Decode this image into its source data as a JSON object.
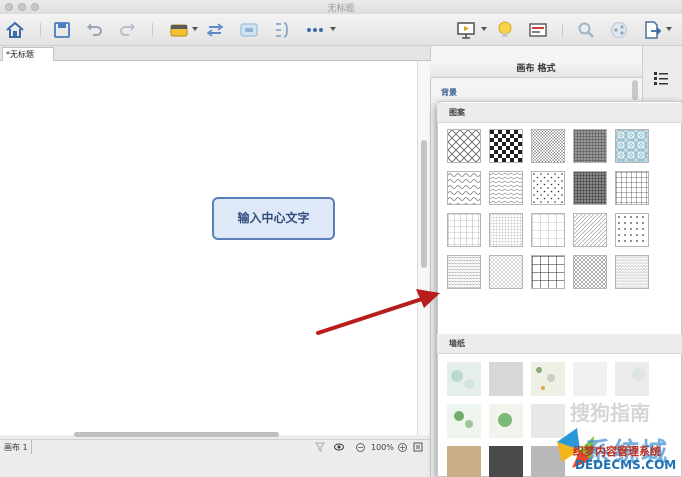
{
  "window": {
    "title": "无标题"
  },
  "toolbar": {
    "icons": [
      "home-icon",
      "save-icon",
      "undo-icon",
      "redo-icon",
      "insert-topic-icon",
      "relationship-icon",
      "boundary-icon",
      "summary-icon",
      "more-icon",
      "presentation-icon",
      "idea-icon",
      "outliner-icon",
      "search-icon",
      "share-icon",
      "export-icon"
    ]
  },
  "tabs": {
    "document": "*无标题"
  },
  "canvas": {
    "central_topic": "输入中心文字"
  },
  "statusbar": {
    "sheet": "画布 1",
    "zoom": "100%",
    "zoom_out": "−",
    "zoom_in": "+"
  },
  "panel": {
    "title": "画布 格式",
    "background_label": "背景",
    "patterns_heading": "图案",
    "wallpaper_heading": "墙纸"
  },
  "patterns": [
    "diamond-lattice",
    "checker",
    "fine-crosshatch",
    "dense-grid",
    "ornament-tile",
    "scribble",
    "wave",
    "dots-sparse",
    "dark-grid",
    "square-grid",
    "thin-grid",
    "tight-grid",
    "wide-grid",
    "diagonal-lines",
    "dot-grid",
    "knit",
    "crosshatch-light",
    "bold-grid",
    "weave",
    "speckle"
  ],
  "watermark": {
    "big": "系统城",
    "small": "搜狗指南",
    "cn": "织梦内容管理系统",
    "url": "DEDECMS.COM"
  },
  "colors": {
    "accent": "#5b7fb8",
    "topic_fill": "#dfe8f6",
    "arrow": "#b81c1c",
    "link_blue": "#3a5d8f"
  }
}
